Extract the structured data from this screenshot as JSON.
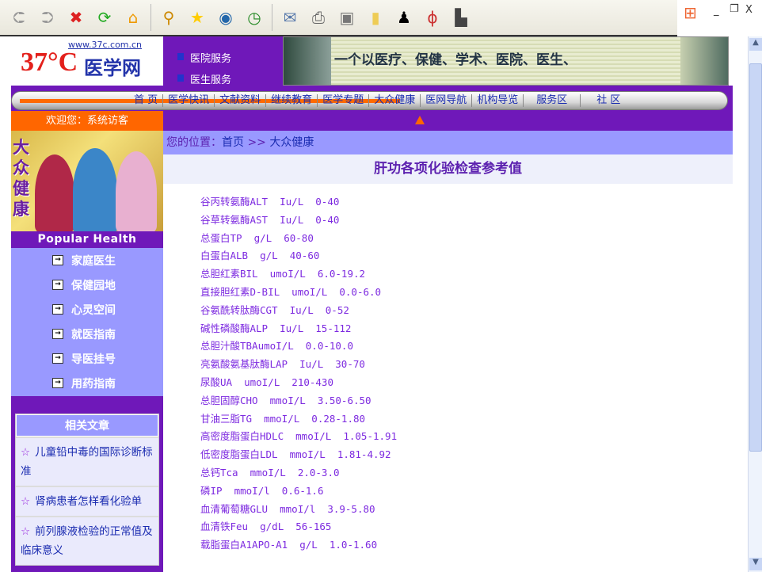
{
  "toolbar": {
    "icons": [
      "back-icon",
      "forward-icon",
      "stop-icon",
      "refresh-icon",
      "home-icon",
      "search-icon",
      "favorites-icon",
      "media-icon",
      "history-icon",
      "mail-icon",
      "print-icon",
      "edit-icon",
      "note-icon",
      "messenger-icon",
      "tool-icon",
      "research-icon"
    ]
  },
  "window": {
    "minimize": "_",
    "restore": "❐",
    "close": "X"
  },
  "logo": {
    "url": "www.37c.com.cn",
    "brand": "37°C",
    "name": "医学网"
  },
  "services": [
    "医院服务",
    "医生服务"
  ],
  "banner": {
    "slogan": "一个以医疗、保健、学术、医院、医生、"
  },
  "nav": [
    "首 页",
    "医学快讯",
    "文献资料",
    "继续教育",
    "医学专题",
    "大众健康",
    "医网导航",
    "机构导览",
    "服务区",
    "社 区"
  ],
  "welcome": "欢迎您：系统访客",
  "sidebar": {
    "photo_title": "大众健康",
    "photo_caption": "Popular Health",
    "menu": [
      "家庭医生",
      "保健园地",
      "心灵空间",
      "就医指南",
      "导医挂号",
      "用药指南"
    ],
    "related_title": "相关文章",
    "related": [
      "儿童铅中毒的国际诊断标准",
      "肾病患者怎样看化验单",
      "前列腺液检验的正常值及临床意义"
    ]
  },
  "breadcrumb": {
    "label": "您的位置：",
    "home": "首页",
    "sep": " >> ",
    "current": "大众健康"
  },
  "article": {
    "title": "肝功各项化验检查参考值",
    "items": [
      "谷丙转氨酶ALT  Iu/L  0-40",
      "谷草转氨酶AST  Iu/L  0-40",
      "总蛋白TP  g/L  60-80",
      "白蛋白ALB  g/L  40-60",
      "总胆红素BIL  umoI/L  6.0-19.2",
      "直接胆红素D-BIL  umoI/L  0.0-6.0",
      "谷氨酰转肽酶CGT  Iu/L  0-52",
      "碱性磷酸酶ALP  Iu/L  15-112",
      "总胆汁酸TBAumoI/L  0.0-10.0",
      "亮氨酸氨基肽酶LAP  Iu/L  30-70",
      "尿酸UA  umoI/L  210-430",
      "总胆固醇CHO  mmoI/L  3.50-6.50",
      "甘油三脂TG  mmoI/L  0.28-1.80",
      "高密度脂蛋白HDLC  mmoI/L  1.05-1.91",
      "低密度脂蛋白LDL  mmoI/L  1.81-4.92",
      "总钙Tca  mmoI/L  2.0-3.0",
      "磷IP  mmoI/l  0.6-1.6",
      "血清葡萄糖GLU  mmoI/l  3.9-5.80",
      "血清铁Feu  g/dL  56-165",
      "载脂蛋白A1APO-A1  g/L  1.0-1.60"
    ]
  }
}
